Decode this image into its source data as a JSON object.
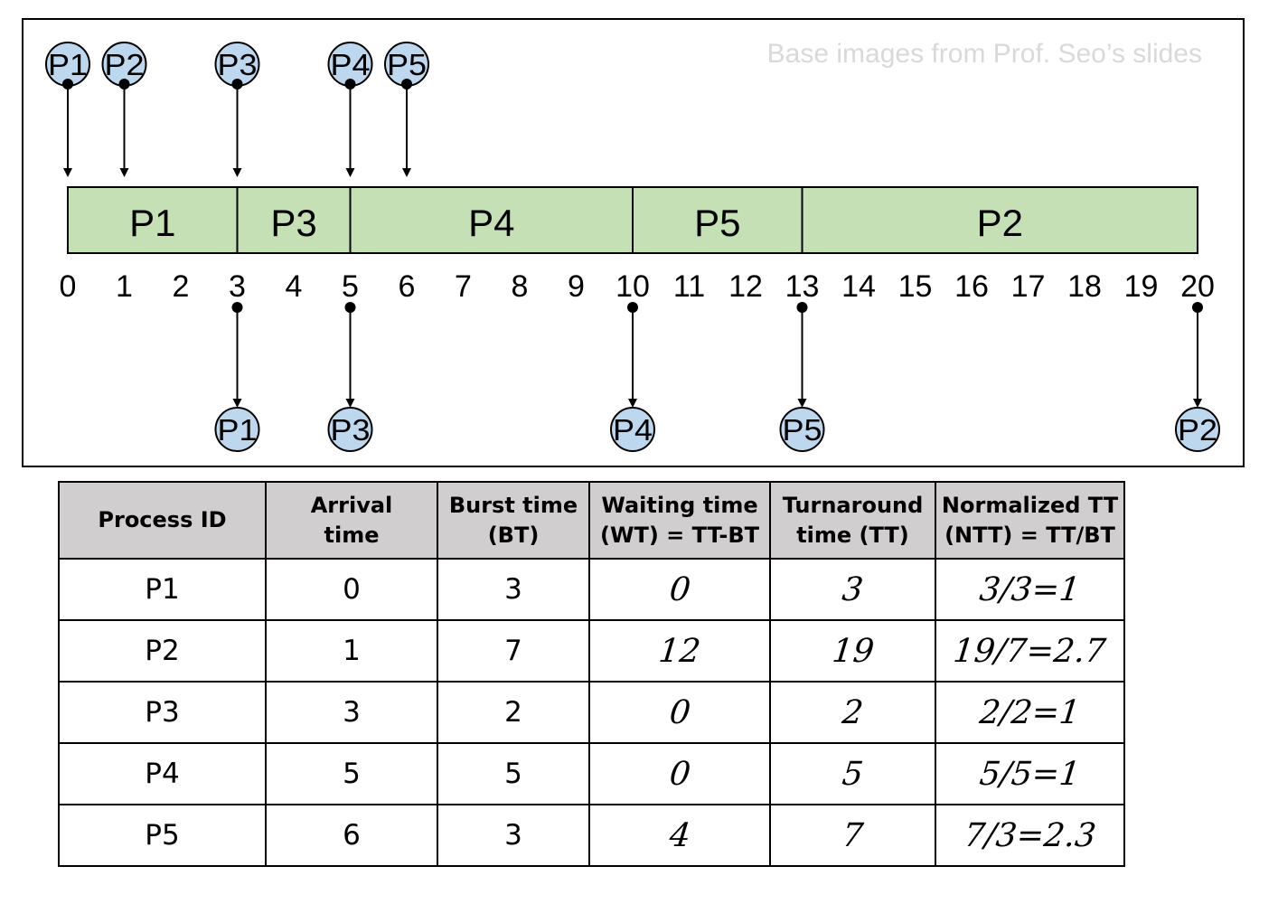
{
  "watermark": "Base images from Prof. Seo’s slides",
  "colors": {
    "segment_fill": "#c5e0b4",
    "process_circle_fill": "#bdd7ee",
    "header_fill": "#d0cece"
  },
  "gantt": {
    "time_start": 0,
    "time_end": 20,
    "ticks": [
      "0",
      "1",
      "2",
      "3",
      "4",
      "5",
      "6",
      "7",
      "8",
      "9",
      "10",
      "11",
      "12",
      "13",
      "14",
      "15",
      "16",
      "17",
      "18",
      "19",
      "20"
    ],
    "segments": [
      {
        "label": "P1",
        "start": 0,
        "end": 3
      },
      {
        "label": "P3",
        "start": 3,
        "end": 5
      },
      {
        "label": "P4",
        "start": 5,
        "end": 10
      },
      {
        "label": "P5",
        "start": 10,
        "end": 13
      },
      {
        "label": "P2",
        "start": 13,
        "end": 20
      }
    ],
    "arrivals": [
      {
        "label": "P1",
        "time": 0
      },
      {
        "label": "P2",
        "time": 1
      },
      {
        "label": "P3",
        "time": 3
      },
      {
        "label": "P4",
        "time": 5
      },
      {
        "label": "P5",
        "time": 6
      }
    ],
    "completions": [
      {
        "label": "P1",
        "time": 3
      },
      {
        "label": "P3",
        "time": 5
      },
      {
        "label": "P4",
        "time": 10
      },
      {
        "label": "P5",
        "time": 13
      },
      {
        "label": "P2",
        "time": 20
      }
    ]
  },
  "table": {
    "headers": [
      [
        "Process ID"
      ],
      [
        "Arrival",
        "time"
      ],
      [
        "Burst time",
        "(BT)"
      ],
      [
        "Waiting time",
        "(WT) = TT-BT"
      ],
      [
        "Turnaround",
        "time (TT)"
      ],
      [
        "Normalized TT",
        "(NTT) = TT/BT"
      ]
    ],
    "rows": [
      [
        "P1",
        "0",
        "3",
        "0",
        "3",
        "3/3=1"
      ],
      [
        "P2",
        "1",
        "7",
        "12",
        "19",
        "19/7=2.7"
      ],
      [
        "P3",
        "3",
        "2",
        "0",
        "2",
        "2/2=1"
      ],
      [
        "P4",
        "5",
        "5",
        "0",
        "5",
        "5/5=1"
      ],
      [
        "P5",
        "6",
        "3",
        "4",
        "7",
        "7/3=2.3"
      ]
    ]
  }
}
